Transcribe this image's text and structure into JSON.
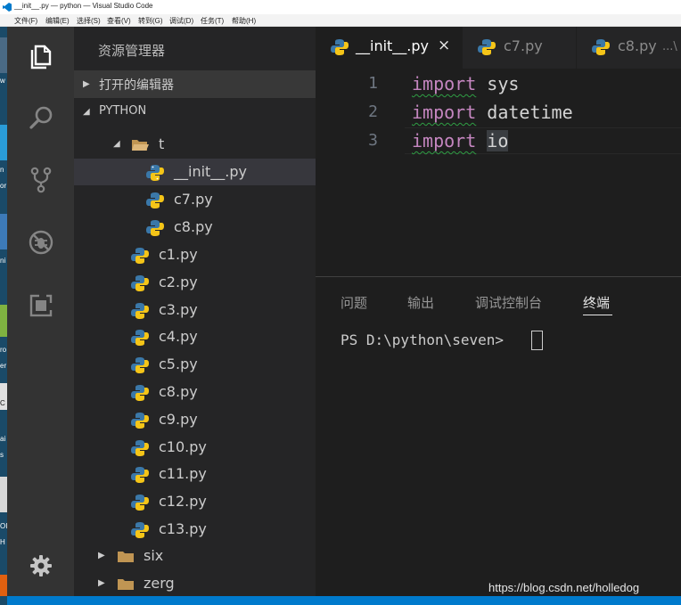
{
  "window": {
    "title": "__init__.py — python — Visual Studio Code",
    "menu": [
      "文件(F)",
      "编辑(E)",
      "选择(S)",
      "查看(V)",
      "转到(G)",
      "调试(D)",
      "任务(T)",
      "帮助(H)"
    ]
  },
  "desktop_strip": [
    "w",
    "n",
    "or",
    "ni",
    "ro",
    "er",
    "C",
    "ai",
    "s",
    "OI",
    "H"
  ],
  "activity_bar": {
    "icons": [
      "explorer-icon",
      "search-icon",
      "source-control-icon",
      "debug-icon",
      "extensions-icon",
      "settings-gear-icon"
    ]
  },
  "sidebar": {
    "title": "资源管理器",
    "open_editors_label": "打开的编辑器",
    "project_label": "PYTHON",
    "folder_t": "t",
    "t_files": [
      "__init__.py",
      "c7.py",
      "c8.py"
    ],
    "root_files": [
      "c1.py",
      "c2.py",
      "c3.py",
      "c4.py",
      "c5.py",
      "c8.py",
      "c9.py",
      "c10.py",
      "c11.py",
      "c12.py",
      "c13.py"
    ],
    "folders": [
      "six",
      "zerg"
    ],
    "selected_file": "__init__.py"
  },
  "tabs": [
    {
      "label": "__init__.py",
      "close": "×"
    },
    {
      "label": "c7.py"
    },
    {
      "label": "c8.py",
      "description": "...\\"
    }
  ],
  "editor": {
    "lines": [
      {
        "number": "1",
        "keyword": "import",
        "module": "sys"
      },
      {
        "number": "2",
        "keyword": "import",
        "module": "datetime"
      },
      {
        "number": "3",
        "keyword": "import",
        "module": "io"
      }
    ]
  },
  "panel": {
    "tabs": [
      "问题",
      "输出",
      "调试控制台",
      "终端"
    ],
    "active_tab": "终端",
    "terminal_prompt": "PS D:\\python\\seven> "
  },
  "watermark": "https://blog.csdn.net/holledog",
  "colors": {
    "activity_bar": "#333333",
    "sidebar": "#252526",
    "editor": "#1e1e1e",
    "keyword": "#c586c0",
    "status_bar": "#007acc",
    "python_blue": "#3b78a8",
    "python_yellow": "#f5c518",
    "folder": "#c09553"
  }
}
